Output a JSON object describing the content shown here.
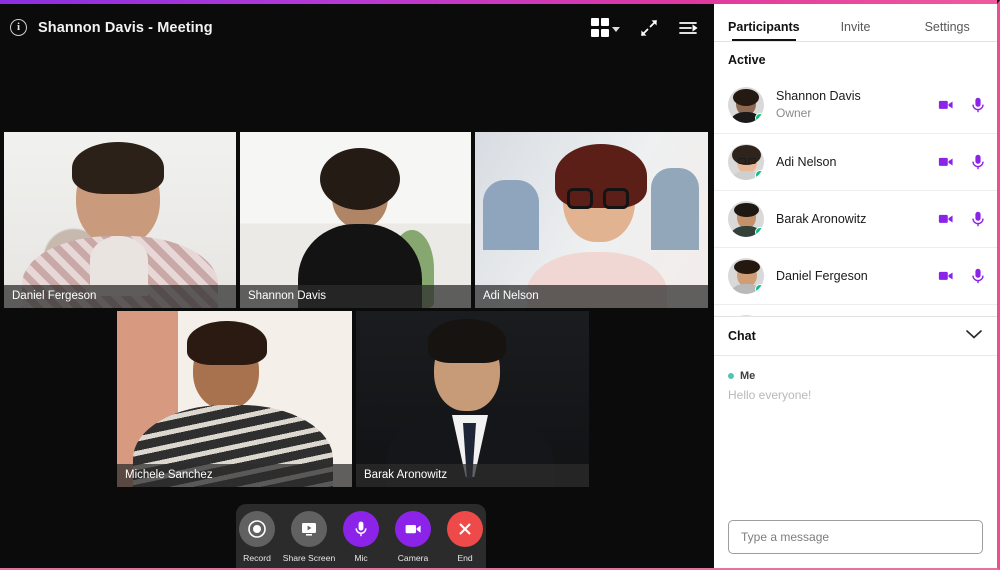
{
  "window": {
    "title": "Shannon Davis - Meeting",
    "info_icon": "info-icon",
    "accent_purple": "#8b24e8",
    "accent_pink": "#ef4d92",
    "end_red": "#ef4a4a"
  },
  "topbar": {
    "layout_icon": "grid-layout-icon",
    "layout_chevron": "chevron-down-icon",
    "fullscreen_icon": "expand-icon",
    "panel_toggle_icon": "collapse-panel-icon"
  },
  "tiles": [
    {
      "name": "Daniel Fergeson"
    },
    {
      "name": "Shannon Davis"
    },
    {
      "name": "Adi Nelson"
    },
    {
      "name": "Michele Sanchez"
    },
    {
      "name": "Barak Aronowitz"
    }
  ],
  "controls": [
    {
      "label": "Record",
      "icon": "record-icon",
      "style": "gray"
    },
    {
      "label": "Share Screen",
      "icon": "share-screen-icon",
      "style": "gray"
    },
    {
      "label": "Mic",
      "icon": "microphone-icon",
      "style": "purple"
    },
    {
      "label": "Camera",
      "icon": "camera-icon",
      "style": "purple"
    },
    {
      "label": "End",
      "icon": "close-icon",
      "style": "red"
    }
  ],
  "sidebar": {
    "tabs": [
      {
        "label": "Participants",
        "active": true
      },
      {
        "label": "Invite",
        "active": false
      },
      {
        "label": "Settings",
        "active": false
      }
    ],
    "section_title": "Active",
    "participants": [
      {
        "name": "Shannon Davis",
        "role": "Owner",
        "online": true
      },
      {
        "name": "Adi Nelson",
        "role": "",
        "online": true
      },
      {
        "name": "Barak Aronowitz",
        "role": "",
        "online": true
      },
      {
        "name": "Daniel Fergeson",
        "role": "",
        "online": true
      },
      {
        "name": "",
        "role": "",
        "online": true
      }
    ],
    "chat": {
      "title": "Chat",
      "collapse_icon": "chevron-down-icon",
      "messages": [
        {
          "author": "Me",
          "text": "Hello everyone!"
        }
      ],
      "input_placeholder": "Type a message",
      "input_value": ""
    }
  }
}
